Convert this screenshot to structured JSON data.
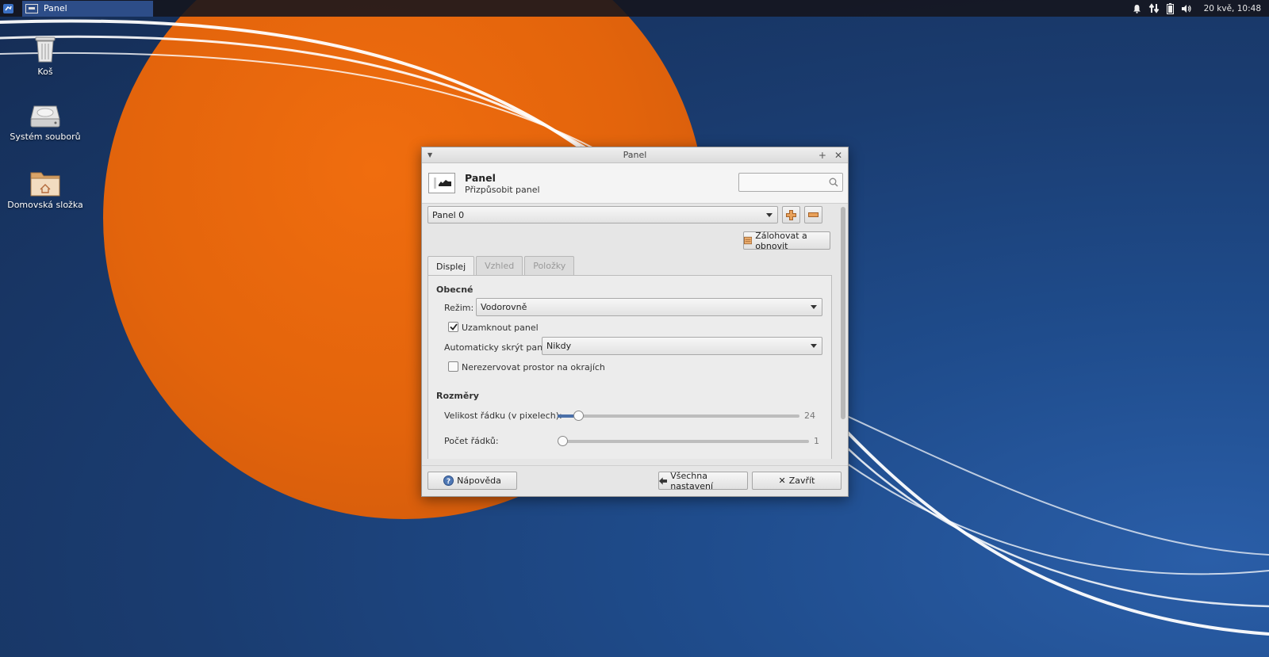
{
  "colors": {
    "wallpaper_orange": "#e8650c",
    "wallpaper_blue": "#1d4784",
    "taskbar_active": "#2d4d88"
  },
  "taskbar": {
    "window_button": "Panel",
    "clock": "20 kvě, 10:48",
    "tray_icons": [
      "bell-icon",
      "network-icon",
      "battery-icon",
      "volume-icon"
    ]
  },
  "desktop": {
    "icons": [
      {
        "label": "Koš",
        "icon": "trash-icon"
      },
      {
        "label": "Systém souborů",
        "icon": "drive-icon"
      },
      {
        "label": "Domovská složka",
        "icon": "home-folder-icon"
      }
    ]
  },
  "window": {
    "title": "Panel",
    "header_title": "Panel",
    "header_subtitle": "Přizpůsobit panel",
    "search_placeholder": "",
    "panel_select": "Panel 0",
    "backup_button": "Zálohovat a obnovit",
    "tabs": [
      {
        "label": "Displej",
        "active": true
      },
      {
        "label": "Vzhled",
        "active": false
      },
      {
        "label": "Položky",
        "active": false
      }
    ],
    "general": {
      "section": "Obecné",
      "mode_label": "Režim:",
      "mode_value": "Vodorovně",
      "lock_label": "Uzamknout panel",
      "lock_checked": true,
      "autohide_label": "Automaticky skrýt panel:",
      "autohide_value": "Nikdy",
      "reserve_label": "Nerezervovat prostor na okrajích",
      "reserve_checked": false
    },
    "dimensions": {
      "section": "Rozměry",
      "row_size_label": "Velikost řádku (v pixelech):",
      "row_size_value": "24",
      "row_size_fraction": 0.07,
      "rows_label": "Počet řádků:",
      "rows_value": "1",
      "rows_fraction": 0.0
    },
    "footer": {
      "help": "Nápověda",
      "all_settings": "Všechna nastavení",
      "close": "Zavřít"
    }
  }
}
